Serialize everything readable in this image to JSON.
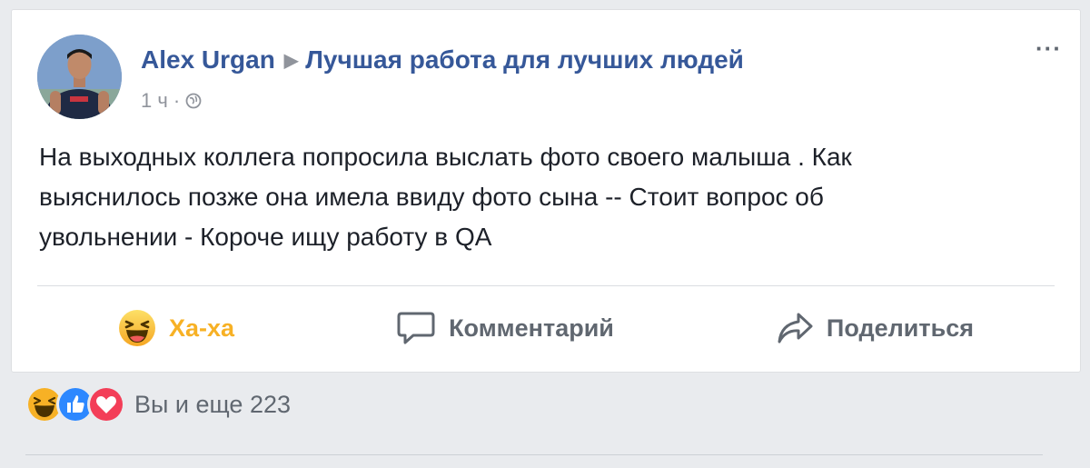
{
  "post": {
    "author": "Alex Urgan",
    "group": "Лучшая работа для лучших людей",
    "time": "1 ч",
    "text_line_1": "На выходных коллега попросила выслать фото своего малыша . Как",
    "text_line_2": "выяснилось позже она имела ввиду фото сына -- Стоит вопрос об",
    "text_line_3": "увольнении - Короче ищу работу в QA"
  },
  "actions": {
    "reaction_label": "Ха-ха",
    "comment_label": "Комментарий",
    "share_label": "Поделиться"
  },
  "summary": {
    "reactions": [
      "haha-icon",
      "like-icon",
      "love-icon"
    ],
    "count_text": "Вы и еще 223"
  },
  "colors": {
    "link_blue": "#365899",
    "haha_yellow": "#f7b125",
    "like_blue": "#2d88ff",
    "love_red": "#f33e58",
    "text_gray": "#606770"
  }
}
